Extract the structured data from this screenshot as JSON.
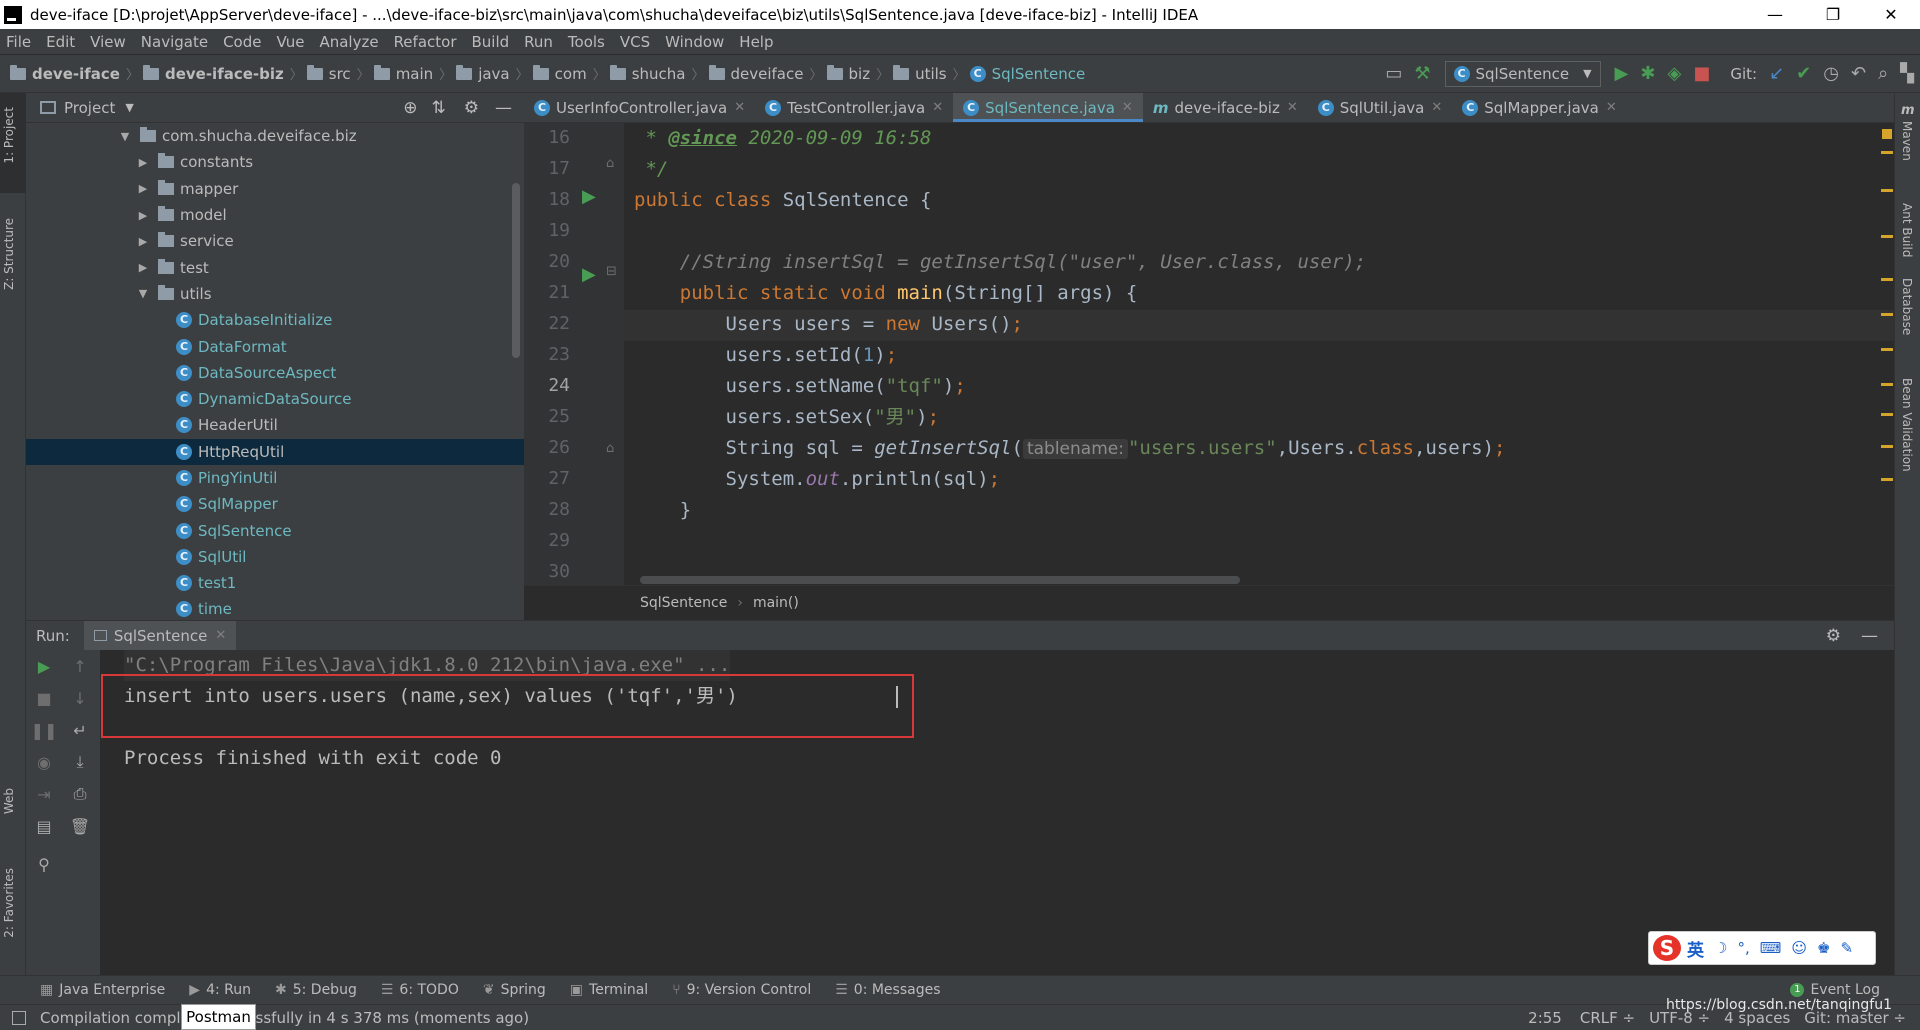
{
  "window": {
    "title": "deve-iface [D:\\projet\\AppServer\\deve-iface] - ...\\deve-iface-biz\\src\\main\\java\\com\\shucha\\deveiface\\biz\\utils\\SqlSentence.java [deve-iface-biz] - IntelliJ IDEA",
    "minimize": "—",
    "restore": "❐",
    "close": "✕"
  },
  "menu": [
    "File",
    "Edit",
    "View",
    "Navigate",
    "Code",
    "Vue",
    "Analyze",
    "Refactor",
    "Build",
    "Run",
    "Tools",
    "VCS",
    "Window",
    "Help"
  ],
  "breadcrumbs": [
    "deve-iface",
    "deve-iface-biz",
    "src",
    "main",
    "java",
    "com",
    "shucha",
    "deveiface",
    "biz",
    "utils",
    "SqlSentence"
  ],
  "toolbar": {
    "run_config": "SqlSentence",
    "git_label": "Git:"
  },
  "left_strip": {
    "project": "1: Project",
    "structure": "Z: Structure",
    "web": "Web",
    "favorites": "2: Favorites"
  },
  "right_strip": {
    "maven": "Maven",
    "ant": "Ant Build",
    "database": "Database",
    "bean": "Bean Validation"
  },
  "project": {
    "header": "Project",
    "tree": [
      {
        "label": "com.shucha.deveiface.biz",
        "kind": "pkg",
        "open": true,
        "indent": 0
      },
      {
        "label": "constants",
        "kind": "pkg",
        "open": false,
        "indent": 1
      },
      {
        "label": "mapper",
        "kind": "pkg",
        "open": false,
        "indent": 1
      },
      {
        "label": "model",
        "kind": "pkg",
        "open": false,
        "indent": 1
      },
      {
        "label": "service",
        "kind": "pkg",
        "open": false,
        "indent": 1
      },
      {
        "label": "test",
        "kind": "pkg",
        "open": false,
        "indent": 1
      },
      {
        "label": "utils",
        "kind": "pkg",
        "open": true,
        "indent": 1
      },
      {
        "label": "DatabaseInitialize",
        "kind": "cls",
        "indent": 2
      },
      {
        "label": "DataFormat",
        "kind": "cls",
        "indent": 2
      },
      {
        "label": "DataSourceAspect",
        "kind": "cls",
        "indent": 2
      },
      {
        "label": "DynamicDataSource",
        "kind": "cls",
        "indent": 2
      },
      {
        "label": "HeaderUtil",
        "kind": "cls",
        "indent": 2,
        "plain": true
      },
      {
        "label": "HttpReqUtil",
        "kind": "cls",
        "indent": 2,
        "plain": true,
        "selected": true
      },
      {
        "label": "PingYinUtil",
        "kind": "cls",
        "indent": 2
      },
      {
        "label": "SqlMapper",
        "kind": "cls",
        "indent": 2
      },
      {
        "label": "SqlSentence",
        "kind": "cls",
        "indent": 2
      },
      {
        "label": "SqlUtil",
        "kind": "cls",
        "indent": 2
      },
      {
        "label": "test1",
        "kind": "cls",
        "indent": 2
      },
      {
        "label": "time",
        "kind": "cls",
        "indent": 2
      }
    ]
  },
  "editor": {
    "tabs": [
      {
        "label": "UserInfoController.java",
        "icon": "C"
      },
      {
        "label": "TestController.java",
        "icon": "C"
      },
      {
        "label": "SqlSentence.java",
        "icon": "C",
        "active": true
      },
      {
        "label": "deve-iface-biz",
        "icon": "m"
      },
      {
        "label": "SqlUtil.java",
        "icon": "C"
      },
      {
        "label": "SqlMapper.java",
        "icon": "C"
      }
    ],
    "line_numbers": [
      "16",
      "17",
      "18",
      "19",
      "20",
      "21",
      "22",
      "23",
      "24",
      "25",
      "26",
      "27",
      "28",
      "29",
      "30"
    ],
    "current_line": "24",
    "breadcrumb": [
      "SqlSentence",
      "main()"
    ],
    "code": {
      "l16_a": " * ",
      "l16_tag": "@since",
      "l16_b": " 2020-09-09 16:58",
      "l17": " */",
      "l18_kw": "public class ",
      "l18_b": "SqlSentence {",
      "l20": "    //String insertSql = getInsertSql(\"user\", User.class, user);",
      "l21_kw": "    public static void ",
      "l21_fn": "main",
      "l21_b": "(String[] args) {",
      "l22_a": "        Users users = ",
      "l22_kw": "new ",
      "l22_b": "Users()",
      "l22_semi": ";",
      "l23_a": "        users.setId(",
      "l23_num": "1",
      "l23_b": ")",
      "l23_semi": ";",
      "l24_a": "        users.setName(",
      "l24_str": "\"tqf\"",
      "l24_b": ")",
      "l24_semi": ";",
      "l25_a": "        users.setSex(",
      "l25_str": "\"男\"",
      "l25_b": ")",
      "l25_semi": ";",
      "l26_a": "        String sql = ",
      "l26_fn": "getInsertSql",
      "l26_p": "(",
      "l26_hint": "tablename:",
      "l26_str": "\"users.users\"",
      "l26_c": ",Users.",
      "l26_kw": "class",
      "l26_d": ",users)",
      "l26_semi": ";",
      "l27_a": "        System.",
      "l27_out": "out",
      "l27_b": ".println(sql)",
      "l27_semi": ";",
      "l28": "    }"
    }
  },
  "run": {
    "label": "Run:",
    "tab": "SqlSentence",
    "console": [
      "\"C:\\Program Files\\Java\\jdk1.8.0_212\\bin\\java.exe\" ...",
      "insert into users.users (name,sex) values ('tqf','男')",
      "",
      "Process finished with exit code 0"
    ]
  },
  "bottom_tools": [
    {
      "label": "Java Enterprise",
      "icon": "▦"
    },
    {
      "label": "4: Run",
      "icon": "▶"
    },
    {
      "label": "5: Debug",
      "icon": "✱"
    },
    {
      "label": "6: TODO",
      "icon": "☰"
    },
    {
      "label": "Spring",
      "icon": "❦"
    },
    {
      "label": "Terminal",
      "icon": "▣"
    },
    {
      "label": "9: Version Control",
      "icon": "⑂"
    },
    {
      "label": "0: Messages",
      "icon": "☰"
    }
  ],
  "event_log": "Event Log",
  "status": {
    "message": "Compilation compl",
    "message_tail": "ssfully in 4 s 378 ms (moments ago)",
    "tooltip": "Postman",
    "position": "2:55",
    "line_sep": "CRLF ÷",
    "encoding": "UTF-8 ÷",
    "indent": "4 spaces",
    "git": "Git: master ÷",
    "watermark": "https://blog.csdn.net/tanqingfu1"
  },
  "ime": {
    "label": "英"
  },
  "colors": {
    "accent": "#4a88c7",
    "highlight_box": "#d9383a",
    "run_green": "#499c54"
  }
}
